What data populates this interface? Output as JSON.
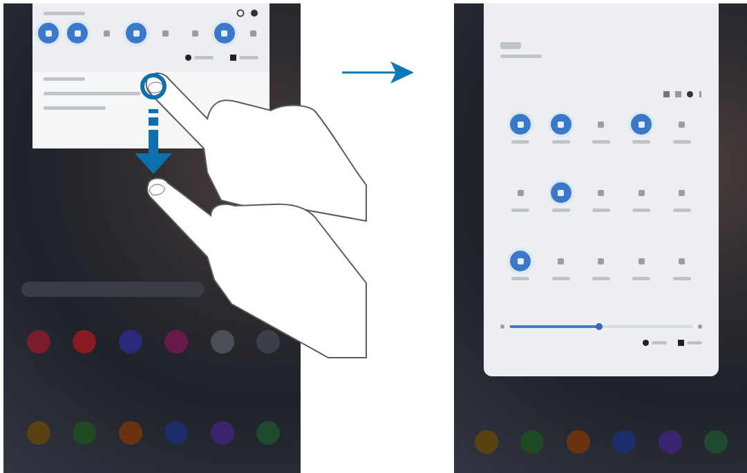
{
  "left_screen": {
    "quick_panel": {
      "tiles": [
        {
          "on": true
        },
        {
          "on": true
        },
        {
          "on": false
        },
        {
          "on": true
        },
        {
          "on": false
        },
        {
          "on": false
        },
        {
          "on": true
        },
        {
          "on": false
        }
      ]
    },
    "home_apps": [
      {
        "color": "#7a1c2c"
      },
      {
        "color": "#8a1a22"
      },
      {
        "color": "#2a2a7a"
      },
      {
        "color": "#6a1a4a"
      },
      {
        "color": "#4a4f55"
      },
      {
        "color": "#3a3f4a"
      }
    ],
    "dock_apps": [
      {
        "color": "#5a4212"
      },
      {
        "color": "#1f4a22"
      },
      {
        "color": "#6a3410"
      },
      {
        "color": "#1c2e6a"
      },
      {
        "color": "#3a2470"
      },
      {
        "color": "#1f4a30"
      }
    ]
  },
  "right_screen": {
    "quick_panel": {
      "tiles": [
        {
          "on": true
        },
        {
          "on": true
        },
        {
          "on": false
        },
        {
          "on": true
        },
        {
          "on": false
        },
        {
          "on": false
        },
        {
          "on": true
        },
        {
          "on": false
        },
        {
          "on": false
        },
        {
          "on": false
        },
        {
          "on": true
        },
        {
          "on": false
        },
        {
          "on": false
        },
        {
          "on": false
        },
        {
          "on": false
        }
      ],
      "brightness": {
        "level": 0.49
      }
    },
    "dock_apps": [
      {
        "color": "#5a4212"
      },
      {
        "color": "#1f4a22"
      },
      {
        "color": "#6a3410"
      },
      {
        "color": "#1c2e6a"
      },
      {
        "color": "#3a2470"
      },
      {
        "color": "#1f4a30"
      }
    ]
  }
}
